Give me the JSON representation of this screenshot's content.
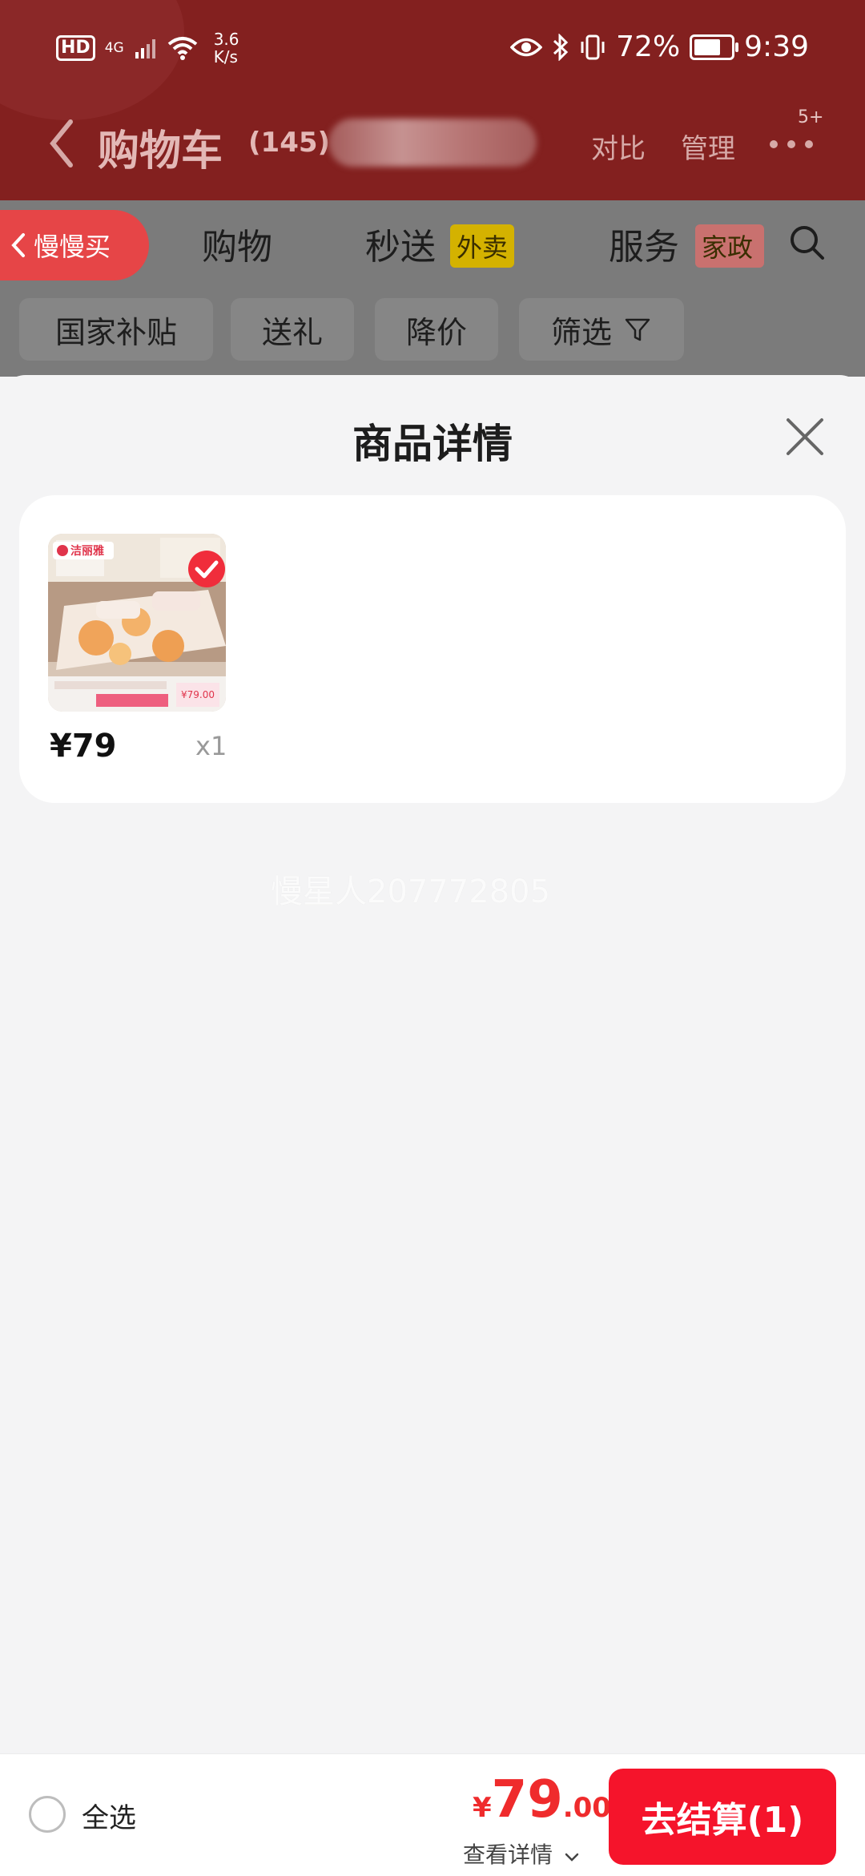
{
  "status_bar": {
    "hd": "HD",
    "network": "4G",
    "speed_value": "3.6",
    "speed_unit": "K/s",
    "battery": "72%",
    "battery_level": 0.72,
    "time": "9:39",
    "icons": [
      "eye-icon",
      "bluetooth-icon",
      "vibrate-icon",
      "battery-icon",
      "signal-icon",
      "wifi-icon"
    ]
  },
  "nav": {
    "title": "购物车",
    "count": "(145)",
    "compare": "对比",
    "manage": "管理",
    "more_badge": "5+"
  },
  "tabs": {
    "slow_buy": "慢慢买",
    "items": [
      {
        "label": "购物"
      },
      {
        "label": "秒送",
        "tag": "外卖"
      },
      {
        "label": "服务",
        "tag": "家政"
      }
    ]
  },
  "filters": [
    "国家补贴",
    "送礼",
    "降价",
    "筛选"
  ],
  "sheet": {
    "title": "商品详情",
    "item": {
      "price": "¥79",
      "quantity": "x1",
      "thumb_brand": "洁丽雅",
      "thumb_price": "¥79.00"
    },
    "watermark": "慢星人207772805"
  },
  "bottom": {
    "select_all": "全选",
    "currency": "¥",
    "total_int": "79",
    "total_dec": ".00",
    "view_detail": "查看详情",
    "checkout": "去结算(1)"
  },
  "colors": {
    "header_bg": "#83201f",
    "accent_red": "#ef2b2c",
    "checkout_bg": "#f5142b",
    "tag_yellow": "#d4b200",
    "tag_pink": "#c9716f"
  }
}
